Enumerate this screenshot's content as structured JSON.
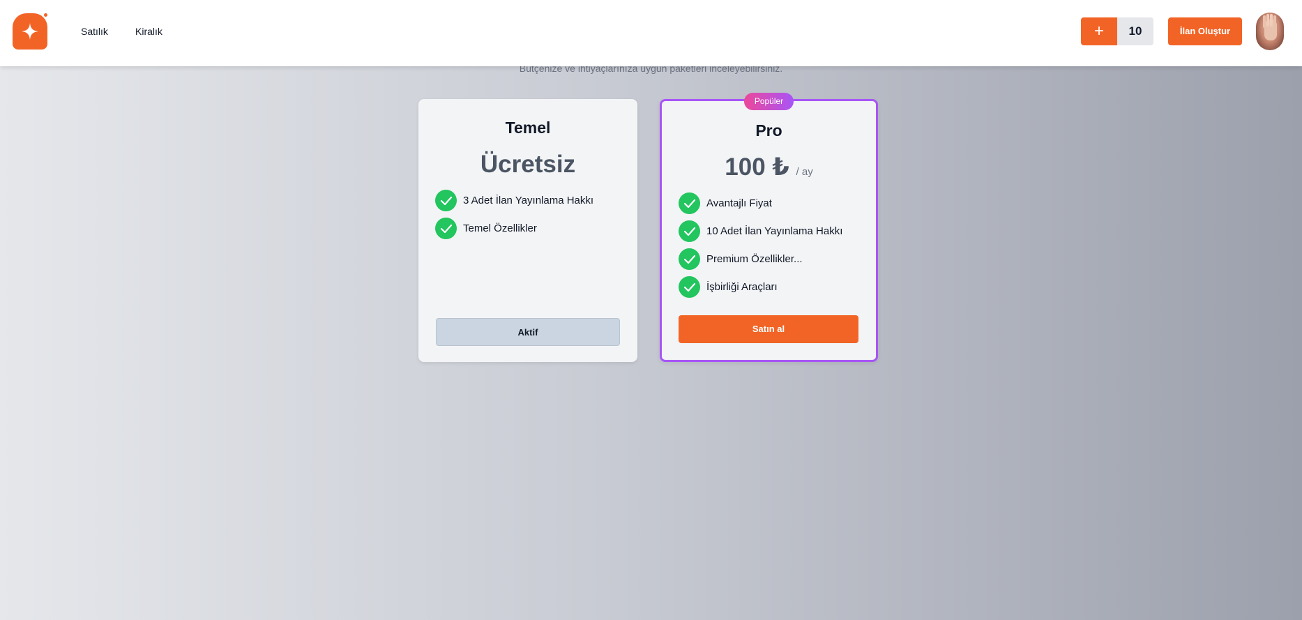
{
  "nav": {
    "links": [
      "Satılık",
      "Kiralık"
    ],
    "plus_label": "+",
    "count": "10",
    "create_label": "İlan Oluştur"
  },
  "subtitle": "Bütçenize ve ihtiyaçlarınıza uygun paketleri inceleyebilirsiniz.",
  "plans": [
    {
      "name": "Temel",
      "price": "Ücretsiz",
      "features": [
        "3 Adet İlan Yayınlama Hakkı",
        "Temel Özellikler"
      ],
      "button": "Aktif"
    },
    {
      "badge": "Popüler",
      "name": "Pro",
      "price": "100 ₺",
      "price_unit": "/ ay",
      "features": [
        "Avantajlı Fiyat",
        "10 Adet İlan Yayınlama Hakkı",
        "Premium Özellikler...",
        "İşbirliği Araçları"
      ],
      "button": "Satın al"
    }
  ],
  "colors": {
    "brand": "#f26426",
    "check": "#22c55e",
    "popular_border": "#a855f7"
  }
}
